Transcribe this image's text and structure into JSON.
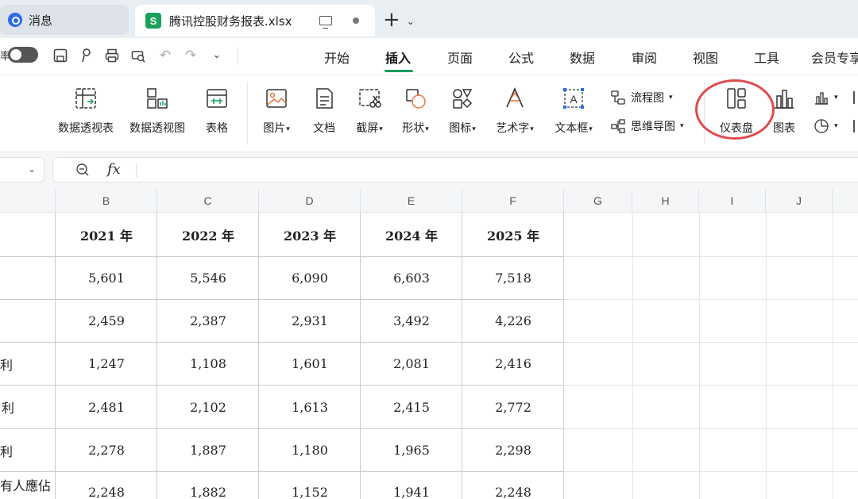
{
  "tabs": {
    "inactive_label": "消息",
    "active_label": "腾讯控股财务报表.xlsx",
    "active_badge": "S"
  },
  "quickbar": {
    "toggle_fragment": "率"
  },
  "menu": {
    "items": [
      "开始",
      "插入",
      "页面",
      "公式",
      "数据",
      "审阅",
      "视图",
      "工具",
      "会员专享"
    ],
    "active": "插入"
  },
  "ribbon": {
    "pivot_table": "数据透视表",
    "pivot_chart": "数据透视图",
    "table": "表格",
    "picture": "图片",
    "document": "文档",
    "screenshot": "截屏",
    "shape": "形状",
    "icon": "图标",
    "wordart": "艺术字",
    "textbox": "文本框",
    "flowchart": "流程图",
    "mindmap": "思维导图",
    "dashboard": "仪表盘",
    "chart": "图表"
  },
  "formula_bar": {
    "fx": "fx",
    "name_value": "",
    "formula_value": ""
  },
  "sheet": {
    "columns": [
      "B",
      "C",
      "D",
      "E",
      "F",
      "G",
      "H",
      "I",
      "J"
    ],
    "year_headers": [
      "2021 年",
      "2022 年",
      "2023 年",
      "2024 年",
      "2025 年"
    ],
    "row_labels": [
      "",
      "",
      "利",
      "利",
      "利",
      "有人應佔"
    ],
    "rows": [
      [
        "5,601",
        "5,546",
        "6,090",
        "6,603",
        "7,518"
      ],
      [
        "2,459",
        "2,387",
        "2,931",
        "3,492",
        "4,226"
      ],
      [
        "1,247",
        "1,108",
        "1,601",
        "2,081",
        "2,416"
      ],
      [
        "2,481",
        "2,102",
        "1,613",
        "2,415",
        "2,772"
      ],
      [
        "2,278",
        "1,887",
        "1,180",
        "1,965",
        "2,298"
      ],
      [
        "2,248",
        "1,882",
        "1,152",
        "1,941",
        "2,248"
      ]
    ]
  },
  "colors": {
    "accent_green": "#17a05a",
    "annotation_red": "#e24b4b"
  }
}
